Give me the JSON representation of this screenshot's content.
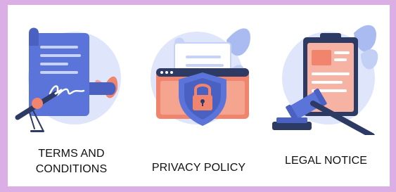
{
  "cards": [
    {
      "label_line1": "TERMS AND",
      "label_line2": "CONDITIONS",
      "illustration": "signing-document-icon"
    },
    {
      "label": "PRIVACY POLICY",
      "illustration": "privacy-shield-lock-icon"
    },
    {
      "label": "LEGAL NOTICE",
      "illustration": "clipboard-gavel-icon"
    }
  ],
  "colors": {
    "frame": "#dcaee6",
    "panel": "#ffffff",
    "primary_blue": "#5b74d9",
    "light_blue": "#dfe6fb",
    "salmon": "#f0846c",
    "dark_navy": "#2d3a64"
  }
}
